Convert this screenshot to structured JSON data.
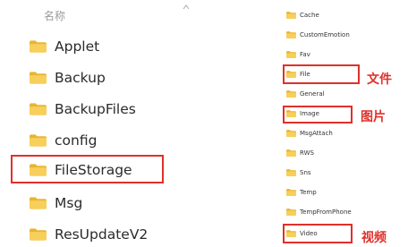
{
  "left_panel": {
    "column_header": "名称",
    "folders": [
      "Applet",
      "Backup",
      "BackupFiles",
      "config",
      "FileStorage",
      "Msg",
      "ResUpdateV2"
    ]
  },
  "right_panel": {
    "folders": [
      "Cache",
      "CustomEmotion",
      "Fav",
      "File",
      "General",
      "Image",
      "MsgAttach",
      "RWS",
      "Sns",
      "Temp",
      "TempFromPhone",
      "Video"
    ]
  },
  "annotations": {
    "file": "文件",
    "image": "图片",
    "video": "视频"
  },
  "colors": {
    "folder_yellow": "#f5c542",
    "highlight_red": "#e0302a"
  }
}
